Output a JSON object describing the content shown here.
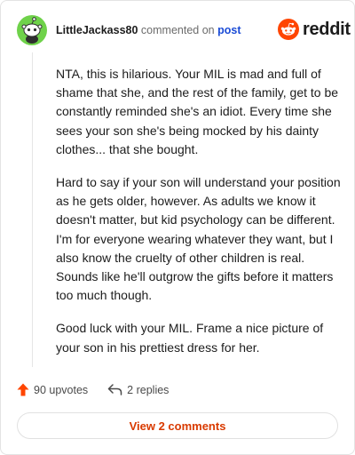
{
  "comment": {
    "username": "LittleJackass80",
    "action_text": "commented on",
    "target_link": "post",
    "paragraphs": [
      "NTA, this is hilarious. Your MIL is mad and full of shame that she, and the rest of the family, get to be constantly reminded she's an idiot. Every time she sees your son she's being mocked by his dainty clothes... that she bought.",
      "Hard to say if your son will understand your position as he gets older, however. As adults we know it doesn't matter, but kid psychology can be different. I'm for everyone wearing whatever they want, but I also know the cruelty of other children is real. Sounds like he'll outgrow the gifts before it matters too much though.",
      "Good luck with your MIL. Frame a nice picture of your son in his prettiest dress for her."
    ],
    "upvotes_label": "90 upvotes",
    "replies_label": "2 replies"
  },
  "brand": {
    "wordmark": "reddit",
    "color": "#ff4500"
  },
  "avatar": {
    "background": "#6fd24a"
  },
  "view_comments_label": "View 2 comments",
  "icons": {
    "avatar": "snoo-avatar-icon",
    "logo": "reddit-snoo-icon",
    "upvote": "upvote-arrow-icon",
    "reply": "reply-arrow-icon"
  }
}
